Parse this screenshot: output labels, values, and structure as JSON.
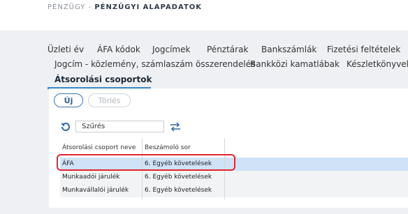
{
  "breadcrumb": {
    "parent": "PÉNZÜGY -",
    "current": "PÉNZÜGYI ALAPADATOK"
  },
  "tabs": {
    "row1": [
      "Üzleti év",
      "ÁFA kódok",
      "Jogcímek",
      "Pénztárak",
      "Bankszámlák",
      "Fizetési feltételek"
    ],
    "row2": [
      "Jogcím - közlemény, számlaszám összerendelés",
      "Bankközi kamatlábak",
      "Készletkönyvelé"
    ],
    "active": "Átsorolási csoportok"
  },
  "toolbar": {
    "new_label": "Új",
    "delete_label": "Törlés"
  },
  "filter": {
    "value": "Szűrés"
  },
  "grid": {
    "columns": [
      "Átsorolási csoport neve",
      "Beszámoló sor"
    ],
    "rows": [
      {
        "name": "ÁFA",
        "line": "6. Egyéb követelések",
        "selected": true
      },
      {
        "name": "Munkaadói járulék",
        "line": "6. Egyéb követelések",
        "selected": false
      },
      {
        "name": "Munkavállalói járulék",
        "line": "6. Egyéb követelések",
        "selected": false
      }
    ]
  },
  "colors": {
    "accent": "#3b86c6",
    "highlight": "#e0262f",
    "selected_row": "#cfe2f7"
  },
  "icons": {
    "refresh": "refresh-icon",
    "swap": "swap-arrows-icon"
  }
}
